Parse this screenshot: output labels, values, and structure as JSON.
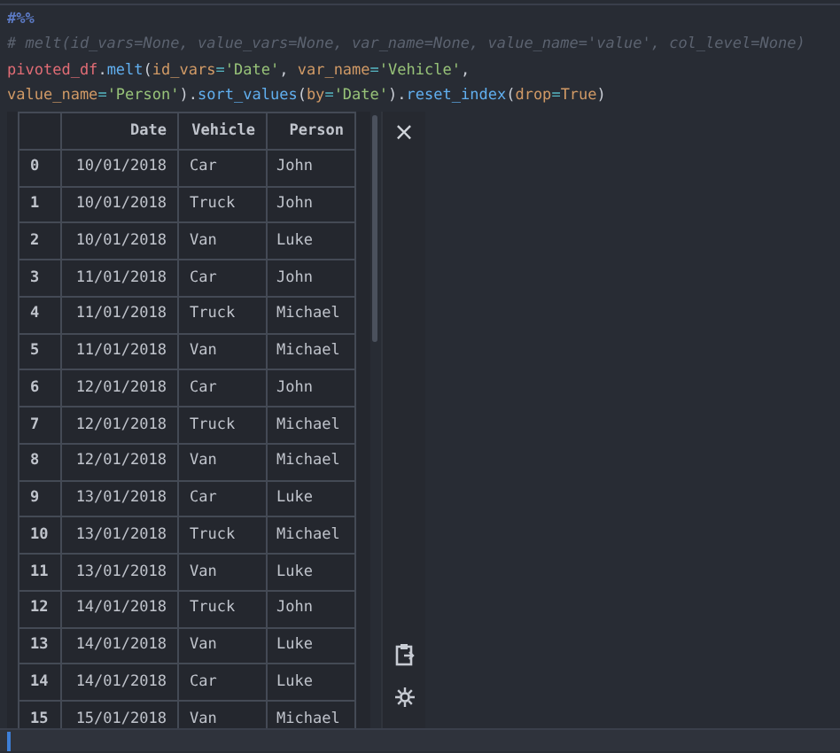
{
  "code_lines": [
    [
      {
        "kind": "cell",
        "text": "#%%"
      }
    ],
    [
      {
        "kind": "comment",
        "text": "# melt(id_vars=None, value_vars=None, var_name=None, value_name='value', col_level=None)"
      }
    ],
    [
      {
        "kind": "var",
        "text": "pivoted_df"
      },
      {
        "kind": "plain",
        "text": "."
      },
      {
        "kind": "func",
        "text": "melt"
      },
      {
        "kind": "plain",
        "text": "("
      },
      {
        "kind": "param",
        "text": "id_vars"
      },
      {
        "kind": "op",
        "text": "="
      },
      {
        "kind": "str",
        "text": "'Date'"
      },
      {
        "kind": "plain",
        "text": ", "
      },
      {
        "kind": "param",
        "text": "var_name"
      },
      {
        "kind": "op",
        "text": "="
      },
      {
        "kind": "str",
        "text": "'Vehicle'"
      },
      {
        "kind": "plain",
        "text": ","
      }
    ],
    [
      {
        "kind": "param",
        "text": "value_name"
      },
      {
        "kind": "op",
        "text": "="
      },
      {
        "kind": "str",
        "text": "'Person'"
      },
      {
        "kind": "plain",
        "text": ")."
      },
      {
        "kind": "func",
        "text": "sort_values"
      },
      {
        "kind": "plain",
        "text": "("
      },
      {
        "kind": "param",
        "text": "by"
      },
      {
        "kind": "op",
        "text": "="
      },
      {
        "kind": "str",
        "text": "'Date'"
      },
      {
        "kind": "plain",
        "text": ")."
      },
      {
        "kind": "func",
        "text": "reset_index"
      },
      {
        "kind": "plain",
        "text": "("
      },
      {
        "kind": "param",
        "text": "drop"
      },
      {
        "kind": "op",
        "text": "="
      },
      {
        "kind": "const",
        "text": "True"
      },
      {
        "kind": "plain",
        "text": ")"
      }
    ]
  ],
  "table": {
    "columns": [
      "",
      "Date",
      "Vehicle",
      "Person"
    ],
    "rows": [
      [
        "0",
        "10/01/2018",
        "Car",
        "John"
      ],
      [
        "1",
        "10/01/2018",
        "Truck",
        "John"
      ],
      [
        "2",
        "10/01/2018",
        "Van",
        "Luke"
      ],
      [
        "3",
        "11/01/2018",
        "Car",
        "John"
      ],
      [
        "4",
        "11/01/2018",
        "Truck",
        "Michael"
      ],
      [
        "5",
        "11/01/2018",
        "Van",
        "Michael"
      ],
      [
        "6",
        "12/01/2018",
        "Car",
        "John"
      ],
      [
        "7",
        "12/01/2018",
        "Truck",
        "Michael"
      ],
      [
        "8",
        "12/01/2018",
        "Van",
        "Michael"
      ],
      [
        "9",
        "13/01/2018",
        "Car",
        "Luke"
      ],
      [
        "10",
        "13/01/2018",
        "Truck",
        "Michael"
      ],
      [
        "11",
        "13/01/2018",
        "Van",
        "Luke"
      ],
      [
        "12",
        "14/01/2018",
        "Truck",
        "John"
      ],
      [
        "13",
        "14/01/2018",
        "Van",
        "Luke"
      ],
      [
        "14",
        "14/01/2018",
        "Car",
        "Luke"
      ],
      [
        "15",
        "15/01/2018",
        "Van",
        "Michael"
      ]
    ]
  },
  "side_panel": {
    "close": "×"
  }
}
